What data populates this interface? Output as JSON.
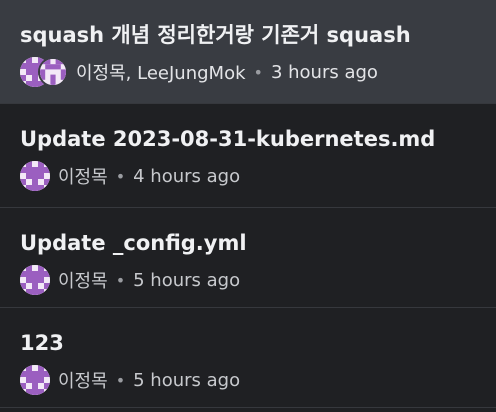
{
  "commits": [
    {
      "title": "squash 개념 정리한거랑 기존거 squash",
      "author": "이정목, LeeJungMok",
      "separator": "•",
      "time": "3 hours ago",
      "selected": true
    },
    {
      "title": "Update 2023-08-31-kubernetes.md",
      "author": "이정목",
      "separator": "•",
      "time": "4 hours ago",
      "selected": false
    },
    {
      "title": "Update _config.yml",
      "author": "이정목",
      "separator": "•",
      "time": "5 hours ago",
      "selected": false
    },
    {
      "title": "123",
      "author": "이정목",
      "separator": "•",
      "time": "5 hours ago",
      "selected": false
    }
  ],
  "colors": {
    "background": "#1f2023",
    "selected_row": "#393c42",
    "avatar_bg": "#f3e9f7",
    "avatar_fg": "#9b5fc0"
  },
  "icons": {
    "avatar": "identicon-avatar-icon"
  }
}
